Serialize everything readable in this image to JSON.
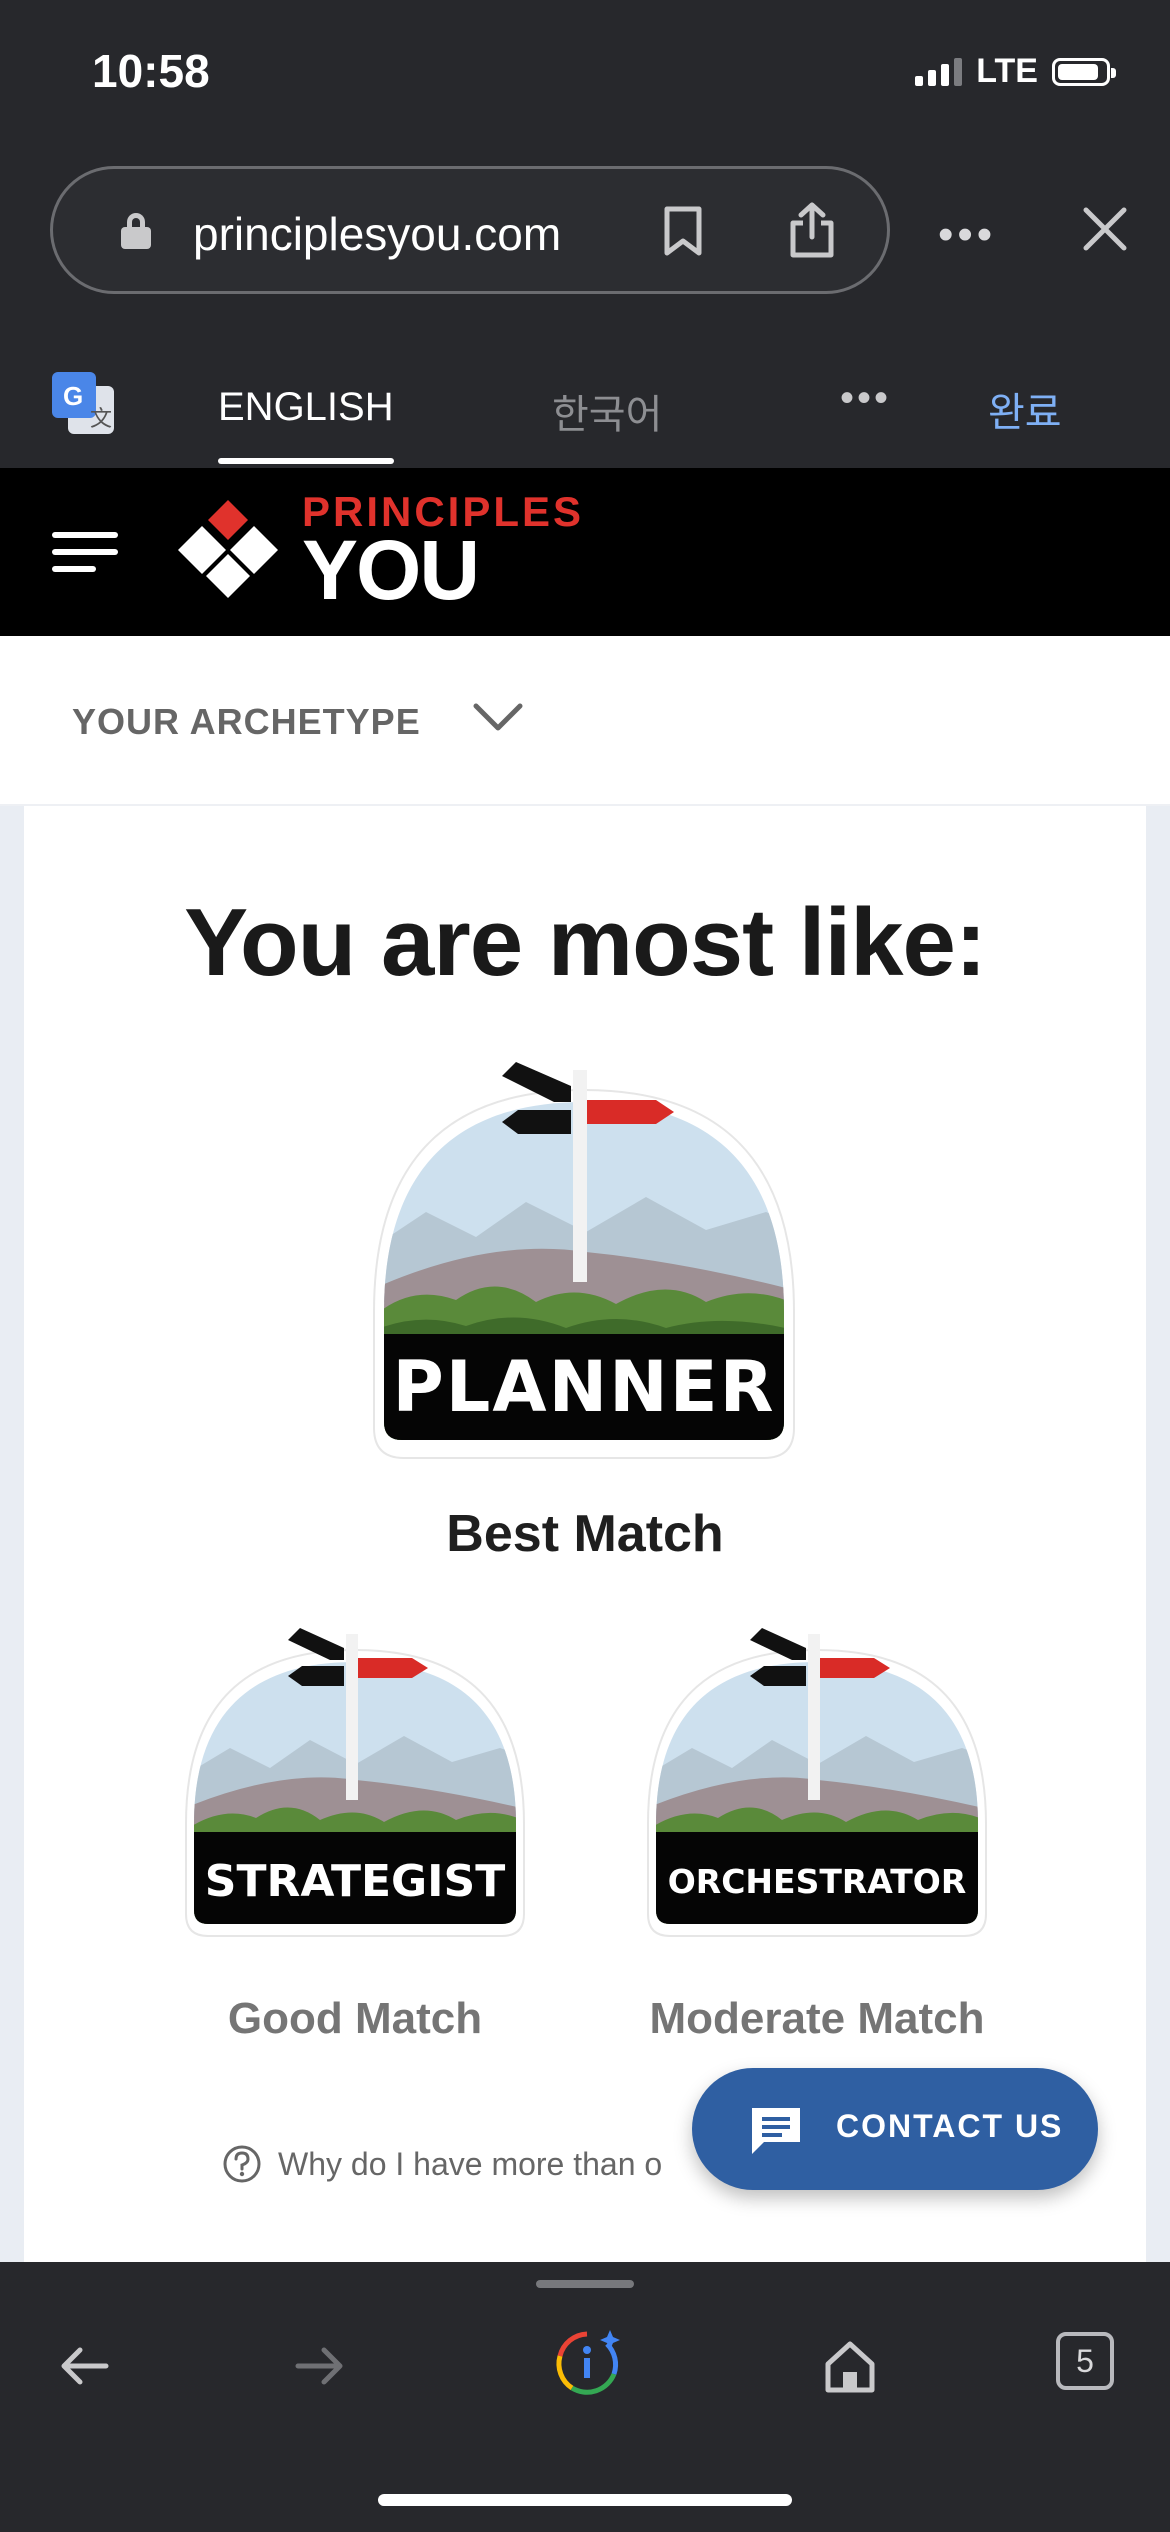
{
  "status_bar": {
    "time": "10:58",
    "network": "LTE"
  },
  "browser": {
    "url": "principlesyou.com",
    "translate": {
      "english_tab": "ENGLISH",
      "korean_tab": "한국어",
      "done": "완료"
    },
    "tabs_count": "5"
  },
  "site": {
    "logo_top": "PRINCIPLES",
    "logo_bottom": "YOU",
    "archetype_dropdown": "YOUR ARCHETYPE"
  },
  "results": {
    "headline": "You are most like:",
    "best": {
      "archetype": "PLANNER",
      "match": "Best Match"
    },
    "good": {
      "archetype": "STRATEGIST",
      "match": "Good Match"
    },
    "moderate": {
      "archetype": "ORCHESTRATOR",
      "match": "Moderate Match"
    },
    "why_text": "Why do I have more than o"
  },
  "contact": {
    "label": "CONTACT US"
  },
  "colors": {
    "brand_red": "#e0322c",
    "contact_blue": "#2f5fa2",
    "chrome_dark": "#27282c"
  }
}
